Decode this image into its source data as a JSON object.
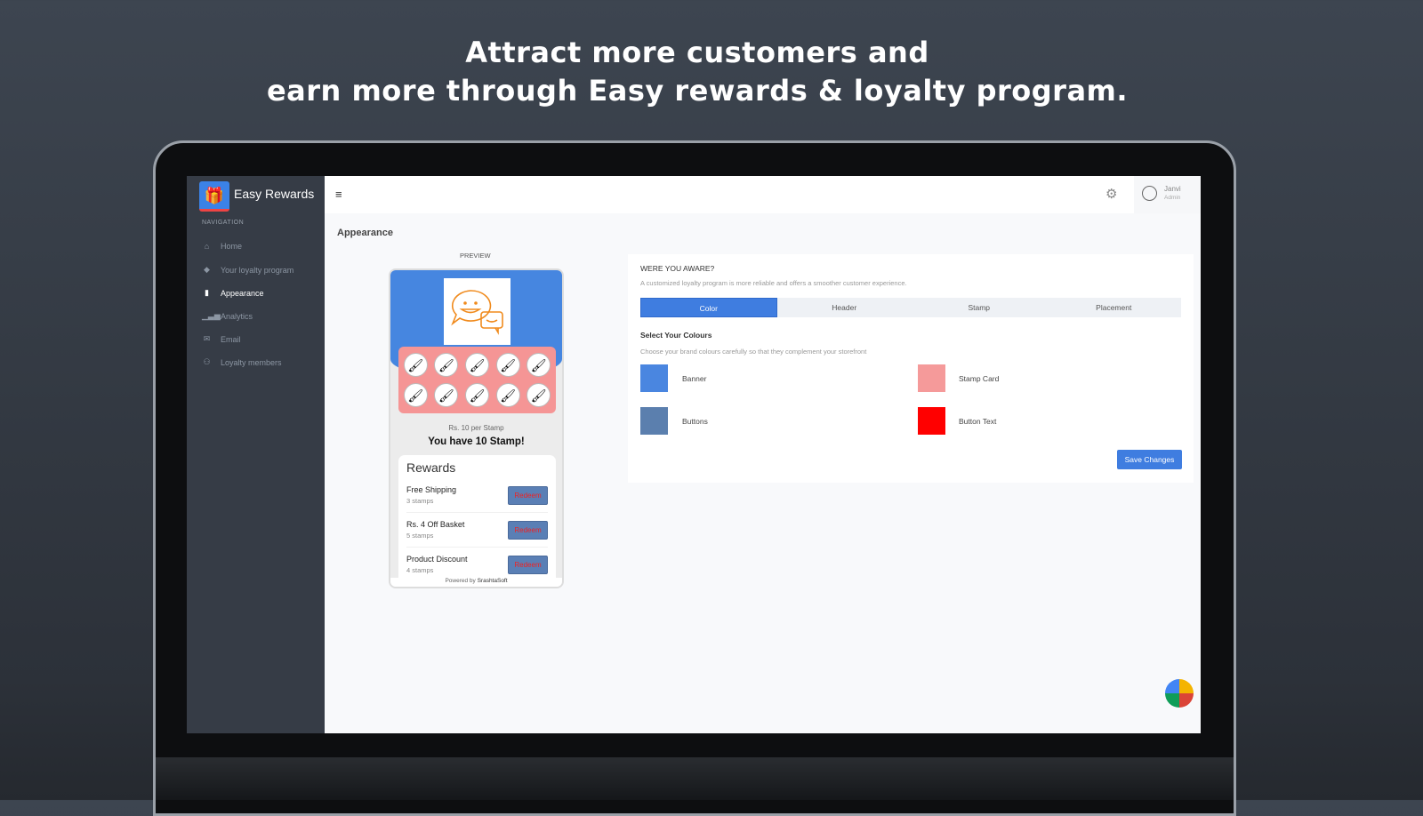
{
  "headline": {
    "line1": "Attract more customers and",
    "line2": "earn more through Easy rewards & loyalty program."
  },
  "app": {
    "name": "Easy Rewards",
    "nav_heading": "NAVIGATION"
  },
  "sidebar": {
    "items": [
      {
        "label": "Home",
        "icon": "store-icon"
      },
      {
        "label": "Your loyalty program",
        "icon": "diamond-icon"
      },
      {
        "label": "Appearance",
        "icon": "paint-icon",
        "active": true
      },
      {
        "label": "Analytics",
        "icon": "bar-chart-icon"
      },
      {
        "label": "Email",
        "icon": "mail-icon"
      },
      {
        "label": "Loyalty members",
        "icon": "users-icon"
      }
    ]
  },
  "header": {
    "user_name": "Janvi",
    "user_role": "Admin"
  },
  "page": {
    "title": "Appearance",
    "preview_label": "PREVIEW"
  },
  "preview": {
    "rate": "Rs. 10 per Stamp",
    "have": "You have 10 Stamp!",
    "rewards_title": "Rewards",
    "rewards": [
      {
        "name": "Free Shipping",
        "stamps": "3 stamps",
        "button": "Redeem"
      },
      {
        "name": "Rs. 4 Off Basket",
        "stamps": "5 stamps",
        "button": "Redeem"
      },
      {
        "name": "Product Discount",
        "stamps": "4 stamps",
        "button": "Redeem"
      }
    ],
    "powered_prefix": "Powered by ",
    "powered_brand": "SrashtaSoft"
  },
  "panel": {
    "aware_title": "WERE YOU AWARE?",
    "aware_text": "A customized loyalty program is more reliable and offers a smoother customer experience.",
    "tabs": [
      "Color",
      "Header",
      "Stamp",
      "Placement"
    ],
    "active_tab": "Color",
    "select_title": "Select Your Colours",
    "select_desc": "Choose your brand colours carefully so that they complement your storefront",
    "colors": [
      {
        "label": "Banner",
        "value": "#4a86e0"
      },
      {
        "label": "Stamp Card",
        "value": "#f59a9a"
      },
      {
        "label": "Buttons",
        "value": "#5b7fae"
      },
      {
        "label": "Button Text",
        "value": "#ff0000"
      }
    ],
    "save": "Save Changes"
  }
}
